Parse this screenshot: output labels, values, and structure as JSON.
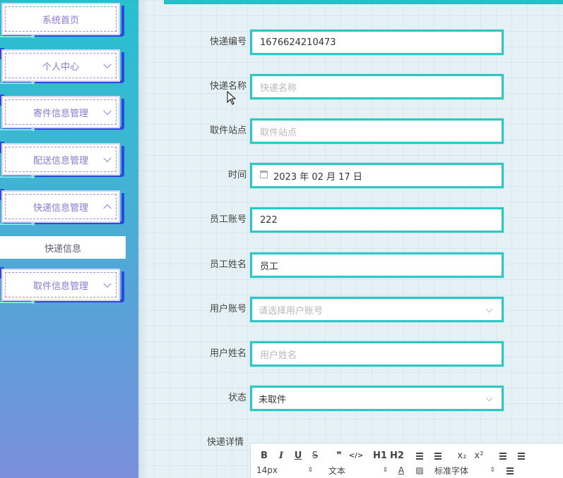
{
  "sidebar": {
    "items": [
      {
        "label": "系统首页",
        "has_chevron": false
      },
      {
        "label": "个人中心",
        "has_chevron": true,
        "expanded": false
      },
      {
        "label": "寄件信息管理",
        "has_chevron": true,
        "expanded": false
      },
      {
        "label": "配送信息管理",
        "has_chevron": true,
        "expanded": false
      },
      {
        "label": "快递信息管理",
        "has_chevron": true,
        "expanded": true
      },
      {
        "label": "取件信息管理",
        "has_chevron": true,
        "expanded": false
      }
    ],
    "submenu": {
      "label": "快递信息"
    }
  },
  "form": {
    "fields": [
      {
        "label": "快递编号",
        "value": "1676624210473",
        "placeholder": ""
      },
      {
        "label": "快递名称",
        "value": "",
        "placeholder": "快递名称"
      },
      {
        "label": "取件站点",
        "value": "",
        "placeholder": "取件站点"
      },
      {
        "label": "时间",
        "value": "2023 年 02 月 17 日",
        "placeholder": ""
      },
      {
        "label": "员工账号",
        "value": "222",
        "placeholder": ""
      },
      {
        "label": "员工姓名",
        "value": "员工",
        "placeholder": ""
      },
      {
        "label": "用户账号",
        "value": "",
        "placeholder": "请选择用户账号"
      },
      {
        "label": "用户姓名",
        "value": "",
        "placeholder": "用户姓名"
      },
      {
        "label": "状态",
        "value": "未取件",
        "placeholder": ""
      }
    ],
    "editor_label": "快递详情"
  },
  "editor_toolbar": {
    "bold": "B",
    "italic": "I",
    "underline": "U",
    "strike": "S",
    "quote": "❞",
    "code": "</>",
    "h1": "H1",
    "h2": "H2",
    "sub": "x₂",
    "sup": "x²",
    "font_size": "14px",
    "block_type": "文本",
    "font_family": "标准字体"
  },
  "colors": {
    "accent": "#2fc6c6",
    "menu_border": "#2c48e0",
    "menu_text": "#8a78d6"
  }
}
